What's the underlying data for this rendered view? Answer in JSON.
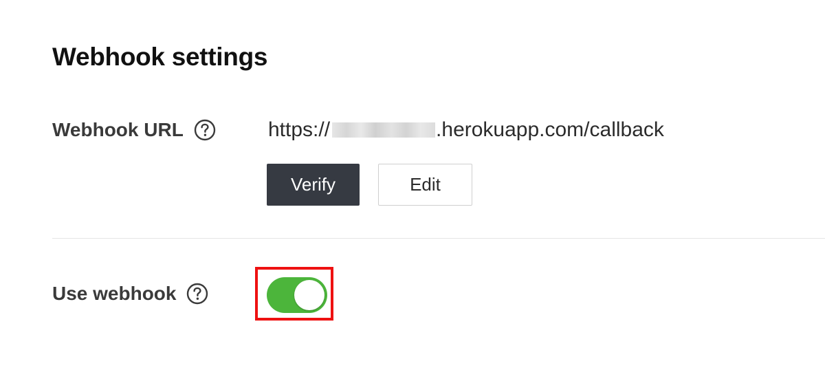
{
  "webhook_settings": {
    "title": "Webhook settings",
    "webhook_url": {
      "label": "Webhook URL",
      "help_icon": "question-circle-icon",
      "value_prefix": "https://",
      "value_suffix": ".herokuapp.com/callback",
      "verify_label": "Verify",
      "edit_label": "Edit"
    },
    "use_webhook": {
      "label": "Use webhook",
      "help_icon": "question-circle-icon",
      "enabled": true,
      "toggle_color": "#4cb53b"
    }
  },
  "colors": {
    "verify_button_bg": "#363a42",
    "highlight_border": "#ee1111"
  }
}
